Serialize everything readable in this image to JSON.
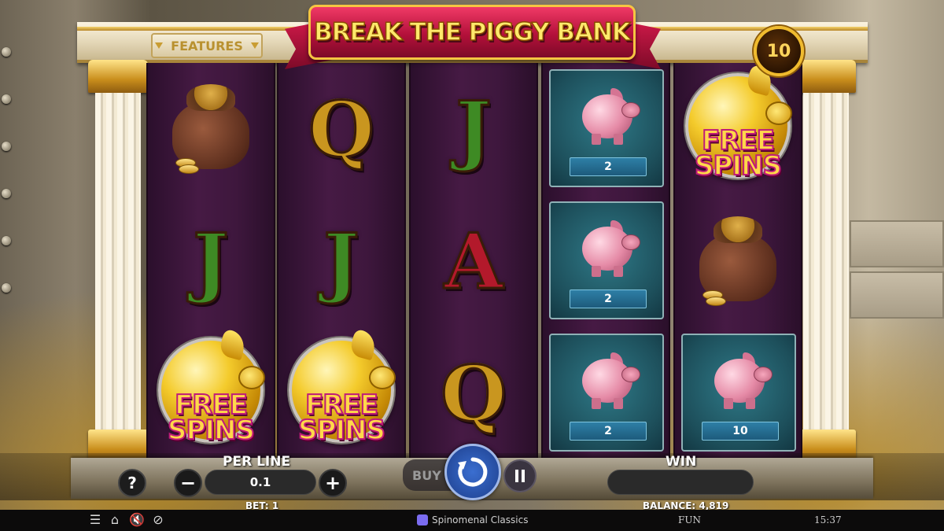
{
  "title": "BREAK THE PIGGY BANK",
  "features_label": "FEATURES",
  "free_spins_counter": "10",
  "reels": [
    [
      {
        "type": "coin-sack"
      },
      {
        "type": "letter",
        "value": "J",
        "color": "green"
      },
      {
        "type": "free-spins",
        "text_line1": "FREE",
        "text_line2": "SPINS"
      }
    ],
    [
      {
        "type": "letter",
        "value": "Q",
        "color": "gold"
      },
      {
        "type": "letter",
        "value": "J",
        "color": "green"
      },
      {
        "type": "free-spins",
        "text_line1": "FREE",
        "text_line2": "SPINS"
      }
    ],
    [
      {
        "type": "letter",
        "value": "J",
        "color": "green"
      },
      {
        "type": "letter",
        "value": "A",
        "color": "red"
      },
      {
        "type": "letter",
        "value": "Q",
        "color": "gold"
      }
    ],
    [
      {
        "type": "piggy",
        "value": "2"
      },
      {
        "type": "piggy",
        "value": "2"
      },
      {
        "type": "piggy",
        "value": "2"
      }
    ],
    [
      {
        "type": "free-spins",
        "text_line1": "FREE",
        "text_line2": "SPINS"
      },
      {
        "type": "coin-sack"
      },
      {
        "type": "piggy",
        "value": "10"
      }
    ]
  ],
  "controls": {
    "help": "?",
    "per_line_label": "PER LINE",
    "per_line_value": "0.1",
    "minus": "−",
    "plus": "+",
    "bet_label": "BET: 1",
    "buy_label": "BUY",
    "win_label": "WIN",
    "win_value": "",
    "balance_label": "BALANCE: 4,819"
  },
  "footer": {
    "brand": "Spinomenal Classics",
    "mode": "FUN",
    "time": "15:37",
    "icons": [
      "menu-icon",
      "home-icon",
      "sound-muted-icon",
      "turbo-icon"
    ]
  },
  "colors": {
    "reel_bg": "#461a44",
    "banner": "#b3103a",
    "gold": "#f0bb2e",
    "piggy_tile": "#1d4f5b"
  }
}
